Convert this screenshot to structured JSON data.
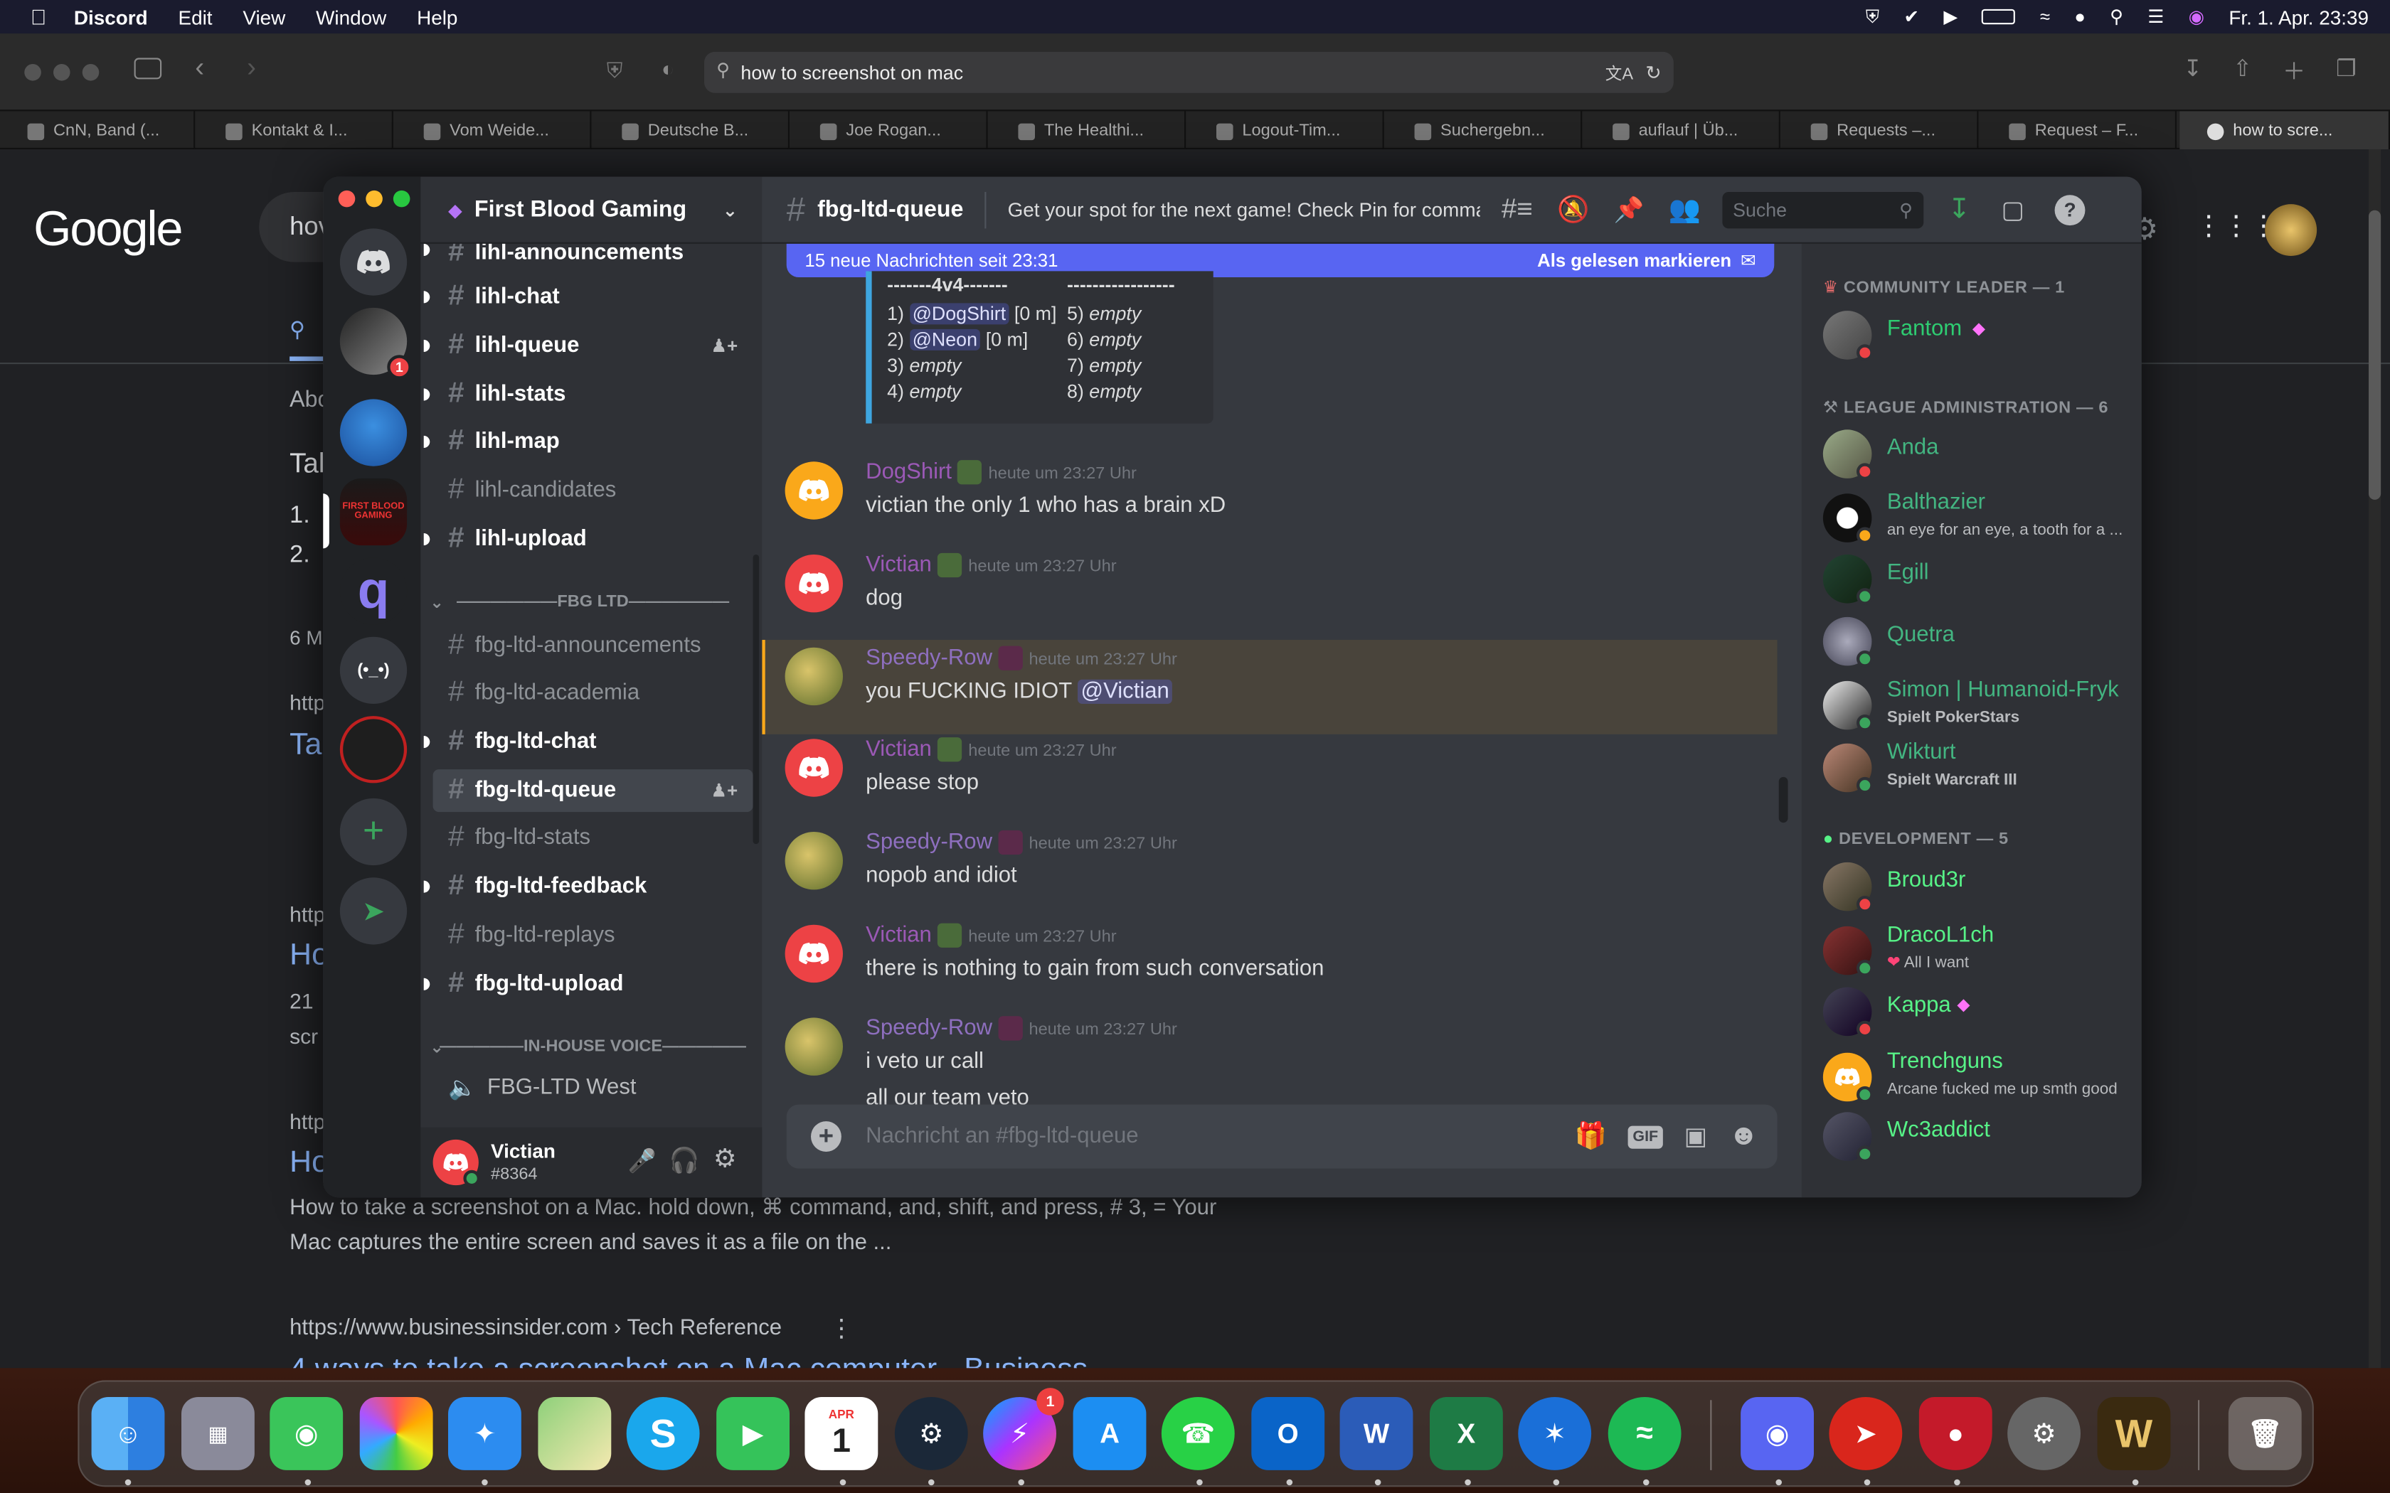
{
  "menubar": {
    "app": "Discord",
    "items": [
      "Edit",
      "View",
      "Window",
      "Help"
    ],
    "datetime": "Fr. 1. Apr.  23:39"
  },
  "browser": {
    "url": "how to screenshot on mac",
    "tabs": [
      "CnN, Band (...",
      "Kontakt & I...",
      "Vom Weide...",
      "Deutsche B...",
      "Joe Rogan...",
      "The Healthi...",
      "Logout-Tim...",
      "Suchergebn...",
      "auflauf | Üb...",
      "Requests –...",
      "Request – F...",
      "how to scre..."
    ]
  },
  "google": {
    "logo": "Google",
    "search_partial": "hov",
    "snips": [
      "Abo",
      "Tal",
      "1.",
      "2.",
      "6 M",
      "http",
      "Ta",
      "http",
      "Ho",
      "21",
      "scr",
      "http",
      "Ho"
    ],
    "result_text_1": "How to take a screenshot on a Mac. hold down, ⌘ command, and, shift, and press, # 3, = Your",
    "result_text_2": "Mac captures the entire screen and saves it as a file on the ...",
    "result_url": "https://www.businessinsider.com › Tech Reference",
    "result_title_partial": "4 ways to take a screenshot on a Mac computer - Business"
  },
  "server": {
    "name": "First Blood Gaming",
    "guild_badge": "1",
    "categories": {
      "fbg_ltd": "FBG LTD",
      "voice": "IN-HOUSE VOICE"
    },
    "channels": [
      {
        "name": "lihl-announcements"
      },
      {
        "name": "lihl-chat"
      },
      {
        "name": "lihl-queue"
      },
      {
        "name": "lihl-stats"
      },
      {
        "name": "lihl-map"
      },
      {
        "name": "lihl-candidates"
      },
      {
        "name": "lihl-upload"
      },
      {
        "name": "fbg-ltd-announcements"
      },
      {
        "name": "fbg-ltd-academia"
      },
      {
        "name": "fbg-ltd-chat"
      },
      {
        "name": "fbg-ltd-queue"
      },
      {
        "name": "fbg-ltd-stats"
      },
      {
        "name": "fbg-ltd-feedback"
      },
      {
        "name": "fbg-ltd-replays"
      },
      {
        "name": "fbg-ltd-upload"
      }
    ],
    "voice_channel": "FBG-LTD West"
  },
  "user": {
    "name": "Victian",
    "tag": "#8364"
  },
  "channel": {
    "name": "fbg-ltd-queue",
    "topic": "Get your spot for the next game! Check Pin for comma...",
    "search_placeholder": "Suche",
    "new_messages": "15 neue Nachrichten seit 23:31",
    "mark_read": "Als gelesen markieren",
    "input_placeholder": "Nachricht an #fbg-ltd-queue"
  },
  "embed": {
    "header_left": "-------4v4-------",
    "header_right": "-----------------",
    "slots": [
      {
        "n": "1)",
        "mention": "@DogShirt",
        "extra": " [0 m]"
      },
      {
        "n": "2)",
        "mention": "@Neon",
        "extra": " [0 m]"
      },
      {
        "n": "3)",
        "empty": "empty"
      },
      {
        "n": "4)",
        "empty": "empty"
      }
    ],
    "slots_right": [
      {
        "n": "5)",
        "empty": "empty"
      },
      {
        "n": "6)",
        "empty": "empty"
      },
      {
        "n": "7)",
        "empty": "empty"
      },
      {
        "n": "8)",
        "empty": "empty"
      }
    ]
  },
  "messages": [
    {
      "user": "DogShirt",
      "time": "heute um 23:27 Uhr",
      "text": "victian the only 1 who has a brain xD"
    },
    {
      "user": "Victian",
      "time": "heute um 23:27 Uhr",
      "text": "dog"
    },
    {
      "user": "Speedy-Row",
      "time": "heute um 23:27 Uhr",
      "text": "you FUCKING IDIOT ",
      "mention": "@Victian"
    },
    {
      "user": "Victian",
      "time": "heute um 23:27 Uhr",
      "text": "please stop"
    },
    {
      "user": "Speedy-Row",
      "time": "heute um 23:27 Uhr",
      "text": "nopob and idiot"
    },
    {
      "user": "Victian",
      "time": "heute um 23:27 Uhr",
      "text": "there is nothing to gain from such conversation"
    },
    {
      "user": "Speedy-Row",
      "time": "heute um 23:27 Uhr",
      "text": "i veto ur call",
      "text2": "all our team veto"
    }
  ],
  "member_groups": [
    {
      "title": "COMMUNITY LEADER — 1",
      "members": [
        {
          "name": "Fantom"
        }
      ]
    },
    {
      "title": "LEAGUE ADMINISTRATION — 6",
      "members": [
        {
          "name": "Anda"
        },
        {
          "name": "Balthazier",
          "status": "an eye for an eye, a tooth for a ..."
        },
        {
          "name": "Egill"
        },
        {
          "name": "Quetra"
        },
        {
          "name": "Simon | Humanoid-Fryk",
          "status": "Spielt PokerStars"
        },
        {
          "name": "Wikturt",
          "status": "Spielt Warcraft III"
        }
      ]
    },
    {
      "title": "DEVELOPMENT — 5",
      "members": [
        {
          "name": "Broud3r"
        },
        {
          "name": "DracoL1ch",
          "status": "All I want"
        },
        {
          "name": "Kappa"
        },
        {
          "name": "Trenchguns",
          "status": "Arcane fucked me up smth good"
        },
        {
          "name": "Wc3addict"
        }
      ]
    }
  ],
  "dock": {
    "calendar_month": "APR",
    "calendar_day": "1",
    "messenger_badge": "1"
  },
  "colors": {
    "blurple": "#5865f2",
    "online": "#3ba55d",
    "dnd": "#ed4245",
    "admin_green": "#43b581",
    "dev_green": "#57f287",
    "purple_role": "#9b59b6",
    "leader_green": "#2ecc71"
  }
}
